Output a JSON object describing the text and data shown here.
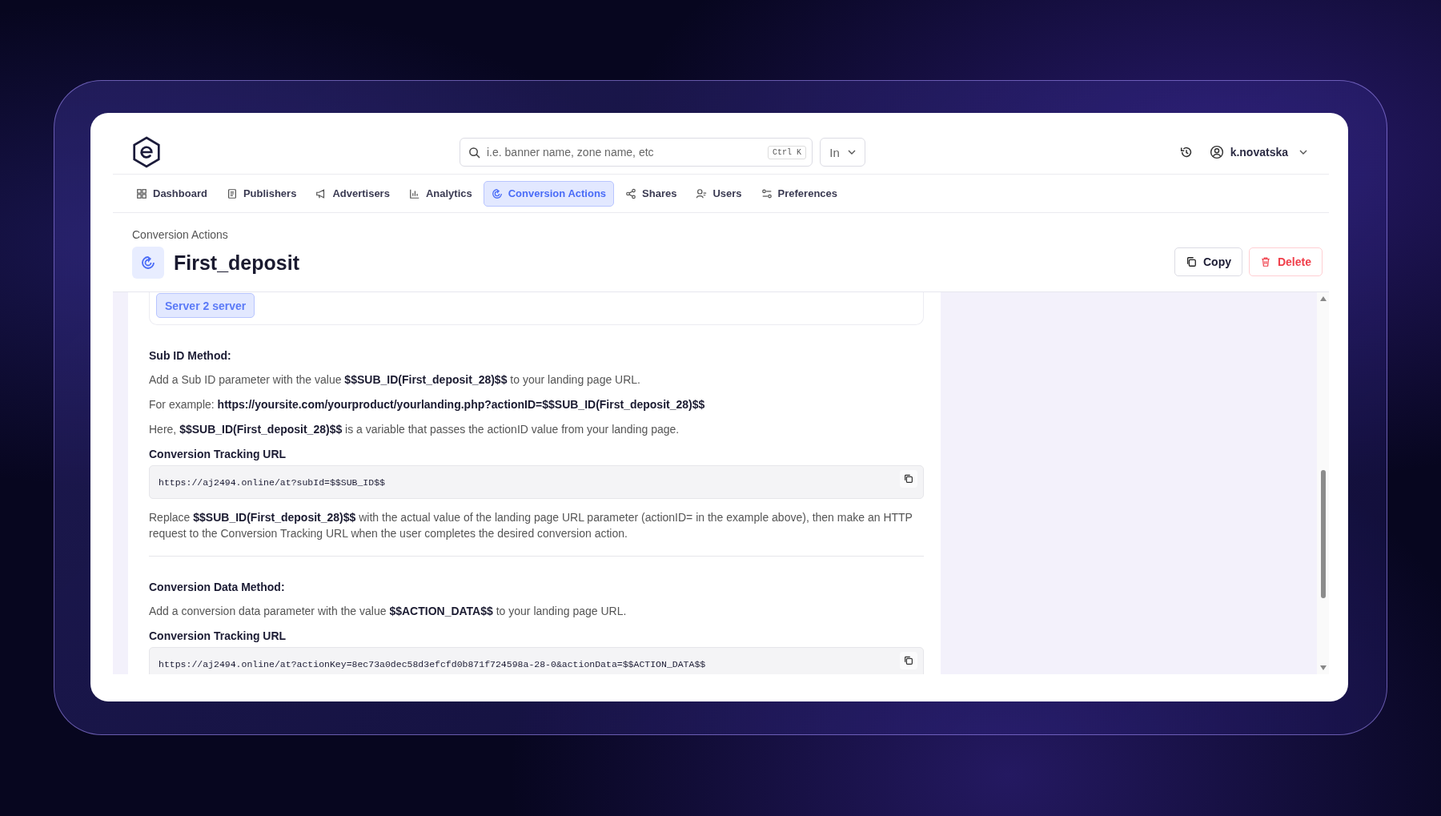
{
  "search": {
    "placeholder": "i.e. banner name, zone name, etc",
    "shortcut": "Ctrl K"
  },
  "scope_dropdown": {
    "value": "In"
  },
  "user_menu": {
    "username": "k.novatska"
  },
  "nav_tabs": [
    {
      "label": "Dashboard",
      "selected": false
    },
    {
      "label": "Publishers",
      "selected": false
    },
    {
      "label": "Advertisers",
      "selected": false
    },
    {
      "label": "Analytics",
      "selected": false
    },
    {
      "label": "Conversion Actions",
      "selected": true
    },
    {
      "label": "Shares",
      "selected": false
    },
    {
      "label": "Users",
      "selected": false
    },
    {
      "label": "Preferences",
      "selected": false
    }
  ],
  "breadcrumb": "Conversion Actions",
  "title": "First_deposit",
  "actions": [
    {
      "label": "Copy",
      "kind": "secondary"
    },
    {
      "label": "Delete",
      "kind": "danger"
    }
  ],
  "integration_types": [
    {
      "label": "Server 2 server",
      "selected": true
    }
  ],
  "sections": [
    {
      "heading": "Sub ID Method:",
      "blocks": [
        {
          "kind": "paragraph",
          "text": "Add a Sub ID parameter with the value **$$SUB_ID(First_deposit_28)$$** to your landing page URL."
        },
        {
          "kind": "paragraph",
          "text": "For example: **https://yoursite.com/yourproduct/yourlanding.php?actionID=$$SUB_ID(First_deposit_28)$$**"
        },
        {
          "kind": "paragraph",
          "text": "Here, **$$SUB_ID(First_deposit_28)$$** is a variable that passes the actionID value from your landing page."
        },
        {
          "kind": "label",
          "text": "Conversion Tracking URL"
        },
        {
          "kind": "code",
          "text": "https://aj2494.online/at?subId=$$SUB_ID$$"
        },
        {
          "kind": "paragraph",
          "text": "Replace **$$SUB_ID(First_deposit_28)$$** with the actual value of the landing page URL parameter (actionID= in the example above), then make an HTTP request to the Conversion Tracking URL when the user completes the desired conversion action."
        }
      ]
    },
    {
      "heading": "Conversion Data Method:",
      "blocks": [
        {
          "kind": "paragraph",
          "text": "Add a conversion data parameter with the value **$$ACTION_DATA$$** to your landing page URL."
        },
        {
          "kind": "label",
          "text": "Conversion Tracking URL"
        },
        {
          "kind": "code",
          "text": "https://aj2494.online/at?actionKey=8ec73a0dec58d3efcfd0b871f724598a-28-0&actionData=$$ACTION_DATA$$"
        }
      ]
    }
  ]
}
